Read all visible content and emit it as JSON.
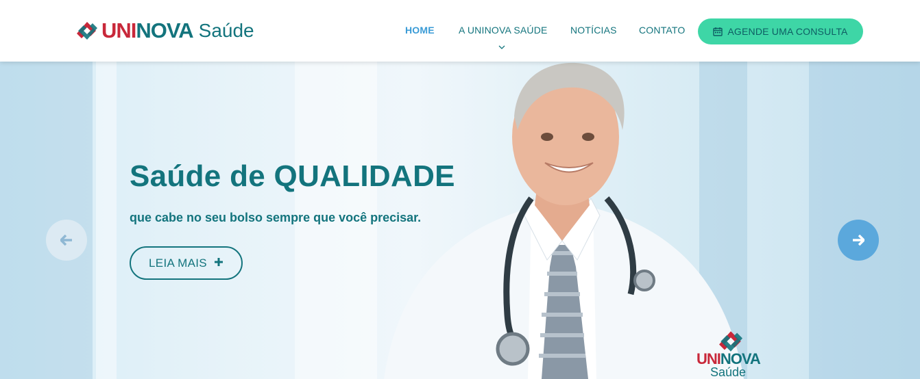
{
  "header": {
    "logo": {
      "uni": "UNI",
      "nova": "NOVA",
      "saude": "Saúde"
    },
    "nav": [
      {
        "label": "HOME",
        "active": true
      },
      {
        "label": "A UNINOVA SAÚDE",
        "has_dropdown": true
      },
      {
        "label": "NOTÍCIAS"
      },
      {
        "label": "CONTATO"
      }
    ],
    "cta_label": "AGENDE UMA CONSULTA",
    "cta_icon": "calendar-icon"
  },
  "hero": {
    "title": "Saúde de QUALIDADE",
    "subtitle": "que cabe no seu bolso sempre que você precisar.",
    "button_label": "LEIA MAIS",
    "button_icon": "plus-icon",
    "prev_icon": "arrow-left-icon",
    "next_icon": "arrow-right-icon",
    "badge": {
      "uni": "UNI",
      "nova": "NOVA",
      "saude": "Saúde"
    }
  },
  "colors": {
    "brand_red": "#c8283a",
    "brand_teal": "#13747d",
    "nav_active": "#3a9bd6",
    "cta_green": "#3ed6a6",
    "next_arrow_blue": "#5ba8dc"
  }
}
